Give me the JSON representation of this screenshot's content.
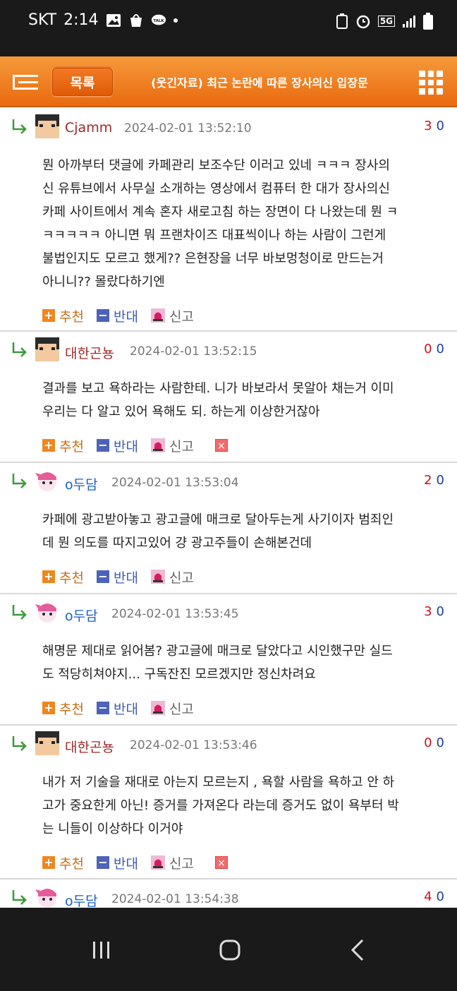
{
  "statusbar": {
    "carrier": "SKT",
    "time": "2:14",
    "network": "5G"
  },
  "header": {
    "list_button": "목록",
    "title": "(웃긴자료) 최근 논란에 따른 장사의신 입장문"
  },
  "actions": {
    "recommend": "추천",
    "oppose": "반대",
    "report": "신고",
    "delete": "×"
  },
  "comments": [
    {
      "nick": "Cjamm",
      "time": "2024-02-01 13:52:10",
      "up": "3",
      "down": "0",
      "lines": [
        "뭔 아까부터 댓글에 카페관리 보조수단 이러고 있네 ㅋㅋㅋ 장사의",
        "신 유튜브에서 사무실 소개하는 영상에서 컴퓨터 한 대가 장사의신",
        "카페 사이트에서 계속 혼자 새로고침 하는 장면이 다 나왔는데 뭔 ㅋ",
        "ㅋㅋㅋㅋㅋ 아니면 뭐 프랜차이즈 대표씩이나 하는 사람이 그런게",
        "불법인지도 모르고 했게?? 은현장을 너무 바보멍청이로 만드는거",
        "아니니?? 몰랐다하기엔"
      ]
    },
    {
      "nick": "대한곤뇽",
      "time": "2024-02-01 13:52:15",
      "up": "0",
      "down": "0",
      "lines": [
        "결과를 보고 욕하라는 사람한테. 니가 바보라서 못알아 채는거 이미",
        "우리는 다 알고 있어 욕해도 되. 하는게 이상한거잖아"
      ]
    },
    {
      "nick": "o두담",
      "time": "2024-02-01 13:53:04",
      "up": "2",
      "down": "0",
      "lines": [
        "카페에 광고받아놓고 광고글에 매크로 달아두는게 사기이자 범죄인",
        "데 뭔 의도를 따지고있어 걍 광고주들이 손해본건데"
      ]
    },
    {
      "nick": "o두담",
      "time": "2024-02-01 13:53:45",
      "up": "3",
      "down": "0",
      "lines": [
        "해명문 제대로 읽어봄? 광고글에 매크로 달았다고 시인했구만 실드",
        "도 적당히쳐야지... 구독잔진 모르겠지만 정신차려요"
      ]
    },
    {
      "nick": "대한곤뇽",
      "time": "2024-02-01 13:53:46",
      "up": "0",
      "down": "0",
      "lines": [
        "내가 저 기술을 재대로 아는지 모르는지 , 욕할 사람을 욕하고 안 하",
        "고가 중요한게 아닌! 증거를 가져온다 라는데 증거도 없이 욕부터 박",
        "는 니들이 이상하다 이거야"
      ]
    },
    {
      "nick": "o두담",
      "time": "2024-02-01 13:54:38",
      "up": "4",
      "down": "0",
      "lines": []
    }
  ]
}
